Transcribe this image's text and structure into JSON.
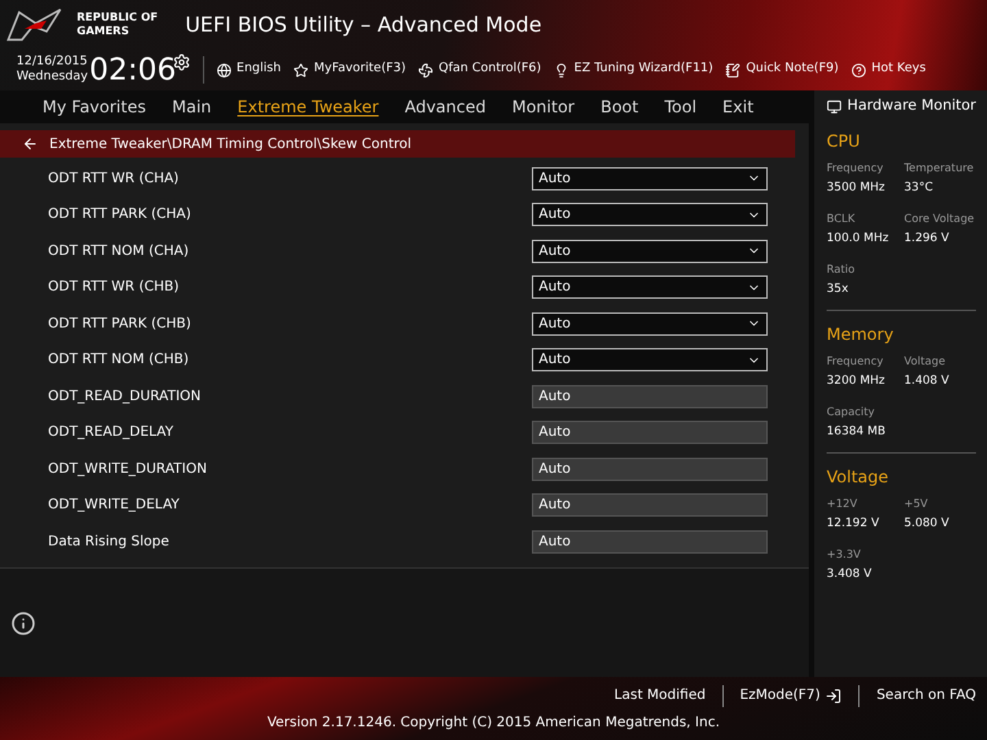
{
  "header": {
    "brand": [
      "REPUBLIC OF",
      "GAMERS"
    ],
    "title": "UEFI BIOS Utility – Advanced Mode"
  },
  "toolbar": {
    "date": "12/16/2015",
    "day": "Wednesday",
    "time": "02:06",
    "items": [
      {
        "kind": "globe",
        "label": "English"
      },
      {
        "kind": "favorite",
        "label": "MyFavorite(F3)"
      },
      {
        "kind": "fan",
        "label": "Qfan Control(F6)"
      },
      {
        "kind": "bulb",
        "label": "EZ Tuning Wizard(F11)"
      },
      {
        "kind": "note",
        "label": "Quick Note(F9)"
      },
      {
        "kind": "help",
        "label": "Hot Keys"
      }
    ]
  },
  "tabs": [
    {
      "label": "My Favorites",
      "selected": false
    },
    {
      "label": "Main",
      "selected": false
    },
    {
      "label": "Extreme Tweaker",
      "selected": true
    },
    {
      "label": "Advanced",
      "selected": false
    },
    {
      "label": "Monitor",
      "selected": false
    },
    {
      "label": "Boot",
      "selected": false
    },
    {
      "label": "Tool",
      "selected": false
    },
    {
      "label": "Exit",
      "selected": false
    }
  ],
  "breadcrumb": "Extreme Tweaker\\DRAM Timing Control\\Skew Control",
  "settings": [
    {
      "label": "ODT RTT WR (CHA)",
      "kind": "dropdown",
      "value": "Auto"
    },
    {
      "label": "ODT RTT PARK (CHA)",
      "kind": "dropdown",
      "value": "Auto"
    },
    {
      "label": "ODT RTT NOM (CHA)",
      "kind": "dropdown",
      "value": "Auto"
    },
    {
      "label": "ODT RTT WR (CHB)",
      "kind": "dropdown",
      "value": "Auto"
    },
    {
      "label": "ODT RTT PARK (CHB)",
      "kind": "dropdown",
      "value": "Auto"
    },
    {
      "label": "ODT RTT NOM (CHB)",
      "kind": "dropdown",
      "value": "Auto"
    },
    {
      "label": "ODT_READ_DURATION",
      "kind": "input",
      "value": "Auto"
    },
    {
      "label": "ODT_READ_DELAY",
      "kind": "input",
      "value": "Auto"
    },
    {
      "label": "ODT_WRITE_DURATION",
      "kind": "input",
      "value": "Auto"
    },
    {
      "label": "ODT_WRITE_DELAY",
      "kind": "input",
      "value": "Auto"
    },
    {
      "label": "Data Rising Slope",
      "kind": "input",
      "value": "Auto"
    }
  ],
  "hardware_monitor": {
    "title": "Hardware Monitor",
    "sections": [
      {
        "title": "CPU",
        "readings": [
          {
            "label": "Frequency",
            "value": "3500 MHz"
          },
          {
            "label": "Temperature",
            "value": "33°C"
          },
          {
            "label": "BCLK",
            "value": "100.0 MHz"
          },
          {
            "label": "Core Voltage",
            "value": "1.296 V"
          },
          {
            "label": "Ratio",
            "value": "35x"
          }
        ]
      },
      {
        "title": "Memory",
        "readings": [
          {
            "label": "Frequency",
            "value": "3200 MHz"
          },
          {
            "label": "Voltage",
            "value": "1.408 V"
          },
          {
            "label": "Capacity",
            "value": "16384 MB"
          }
        ]
      },
      {
        "title": "Voltage",
        "readings": [
          {
            "label": "+12V",
            "value": "12.192 V"
          },
          {
            "label": "+5V",
            "value": "5.080 V"
          },
          {
            "label": "+3.3V",
            "value": "3.408 V"
          }
        ]
      }
    ]
  },
  "footer": {
    "links": [
      {
        "kind": "text",
        "label": "Last Modified"
      },
      {
        "kind": "exit",
        "label": "EzMode(F7)"
      },
      {
        "kind": "text",
        "label": "Search on FAQ"
      }
    ],
    "version": "Version 2.17.1246. Copyright (C) 2015 American Megatrends, Inc."
  }
}
